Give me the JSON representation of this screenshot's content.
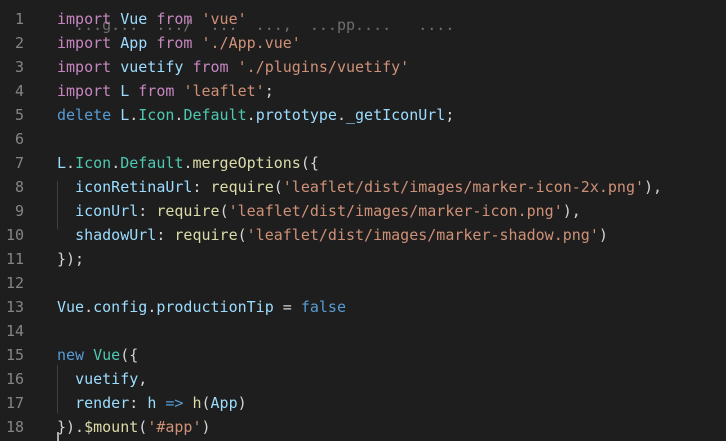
{
  "editor": {
    "top_partial_text": "  ...g...  .../  ...  ...,  ...pp....   ....",
    "lines": [
      {
        "num": "1",
        "tokens": [
          {
            "t": "import",
            "c": "kw"
          },
          {
            "t": " ",
            "c": "pun"
          },
          {
            "t": "Vue",
            "c": "id"
          },
          {
            "t": " ",
            "c": "pun"
          },
          {
            "t": "from",
            "c": "kw"
          },
          {
            "t": " ",
            "c": "pun"
          },
          {
            "t": "'vue'",
            "c": "str"
          }
        ]
      },
      {
        "num": "2",
        "tokens": [
          {
            "t": "import",
            "c": "kw"
          },
          {
            "t": " ",
            "c": "pun"
          },
          {
            "t": "App",
            "c": "id"
          },
          {
            "t": " ",
            "c": "pun"
          },
          {
            "t": "from",
            "c": "kw"
          },
          {
            "t": " ",
            "c": "pun"
          },
          {
            "t": "'./App.vue'",
            "c": "str"
          }
        ]
      },
      {
        "num": "3",
        "tokens": [
          {
            "t": "import",
            "c": "kw"
          },
          {
            "t": " ",
            "c": "pun"
          },
          {
            "t": "vuetify",
            "c": "id"
          },
          {
            "t": " ",
            "c": "pun"
          },
          {
            "t": "from",
            "c": "kw"
          },
          {
            "t": " ",
            "c": "pun"
          },
          {
            "t": "'./plugins/vuetify'",
            "c": "str"
          }
        ]
      },
      {
        "num": "4",
        "tokens": [
          {
            "t": "import",
            "c": "kw"
          },
          {
            "t": " ",
            "c": "pun"
          },
          {
            "t": "L",
            "c": "id"
          },
          {
            "t": " ",
            "c": "pun"
          },
          {
            "t": "from",
            "c": "kw"
          },
          {
            "t": " ",
            "c": "pun"
          },
          {
            "t": "'leaflet'",
            "c": "str"
          },
          {
            "t": ";",
            "c": "pun"
          }
        ]
      },
      {
        "num": "5",
        "tokens": [
          {
            "t": "delete",
            "c": "kw2"
          },
          {
            "t": " ",
            "c": "pun"
          },
          {
            "t": "L",
            "c": "id"
          },
          {
            "t": ".",
            "c": "pun"
          },
          {
            "t": "Icon",
            "c": "cls"
          },
          {
            "t": ".",
            "c": "pun"
          },
          {
            "t": "Default",
            "c": "cls"
          },
          {
            "t": ".",
            "c": "pun"
          },
          {
            "t": "prototype",
            "c": "id"
          },
          {
            "t": ".",
            "c": "pun"
          },
          {
            "t": "_getIconUrl",
            "c": "id"
          },
          {
            "t": ";",
            "c": "pun"
          }
        ]
      },
      {
        "num": "6",
        "tokens": []
      },
      {
        "num": "7",
        "tokens": [
          {
            "t": "L",
            "c": "id"
          },
          {
            "t": ".",
            "c": "pun"
          },
          {
            "t": "Icon",
            "c": "cls"
          },
          {
            "t": ".",
            "c": "pun"
          },
          {
            "t": "Default",
            "c": "cls"
          },
          {
            "t": ".",
            "c": "pun"
          },
          {
            "t": "mergeOptions",
            "c": "fn"
          },
          {
            "t": "({",
            "c": "pun"
          }
        ]
      },
      {
        "num": "8",
        "tokens": [
          {
            "t": "  ",
            "c": "pun"
          },
          {
            "t": "iconRetinaUrl",
            "c": "id"
          },
          {
            "t": ": ",
            "c": "pun"
          },
          {
            "t": "require",
            "c": "fn"
          },
          {
            "t": "(",
            "c": "pun"
          },
          {
            "t": "'leaflet/dist/images/marker-icon-2x.png'",
            "c": "str"
          },
          {
            "t": "),",
            "c": "pun"
          }
        ]
      },
      {
        "num": "9",
        "tokens": [
          {
            "t": "  ",
            "c": "pun"
          },
          {
            "t": "iconUrl",
            "c": "id"
          },
          {
            "t": ": ",
            "c": "pun"
          },
          {
            "t": "require",
            "c": "fn"
          },
          {
            "t": "(",
            "c": "pun"
          },
          {
            "t": "'leaflet/dist/images/marker-icon.png'",
            "c": "str"
          },
          {
            "t": "),",
            "c": "pun"
          }
        ]
      },
      {
        "num": "10",
        "tokens": [
          {
            "t": "  ",
            "c": "pun"
          },
          {
            "t": "shadowUrl",
            "c": "id"
          },
          {
            "t": ": ",
            "c": "pun"
          },
          {
            "t": "require",
            "c": "fn"
          },
          {
            "t": "(",
            "c": "pun"
          },
          {
            "t": "'leaflet/dist/images/marker-shadow.png'",
            "c": "str"
          },
          {
            "t": ")",
            "c": "pun"
          }
        ]
      },
      {
        "num": "11",
        "tokens": [
          {
            "t": "});",
            "c": "pun"
          }
        ]
      },
      {
        "num": "12",
        "tokens": []
      },
      {
        "num": "13",
        "tokens": [
          {
            "t": "Vue",
            "c": "id"
          },
          {
            "t": ".",
            "c": "pun"
          },
          {
            "t": "config",
            "c": "id"
          },
          {
            "t": ".",
            "c": "pun"
          },
          {
            "t": "productionTip",
            "c": "id"
          },
          {
            "t": " = ",
            "c": "pun"
          },
          {
            "t": "false",
            "c": "kw2"
          }
        ]
      },
      {
        "num": "14",
        "tokens": []
      },
      {
        "num": "15",
        "tokens": [
          {
            "t": "new",
            "c": "kw2"
          },
          {
            "t": " ",
            "c": "pun"
          },
          {
            "t": "Vue",
            "c": "cls"
          },
          {
            "t": "({",
            "c": "pun"
          }
        ]
      },
      {
        "num": "16",
        "tokens": [
          {
            "t": "  ",
            "c": "pun"
          },
          {
            "t": "vuetify",
            "c": "id"
          },
          {
            "t": ",",
            "c": "pun"
          }
        ]
      },
      {
        "num": "17",
        "tokens": [
          {
            "t": "  ",
            "c": "pun"
          },
          {
            "t": "render",
            "c": "id"
          },
          {
            "t": ": ",
            "c": "pun"
          },
          {
            "t": "h",
            "c": "id"
          },
          {
            "t": " ",
            "c": "pun"
          },
          {
            "t": "=>",
            "c": "kw2"
          },
          {
            "t": " ",
            "c": "pun"
          },
          {
            "t": "h",
            "c": "fn"
          },
          {
            "t": "(",
            "c": "pun"
          },
          {
            "t": "App",
            "c": "id"
          },
          {
            "t": ")",
            "c": "pun"
          }
        ]
      },
      {
        "num": "18",
        "tokens": [
          {
            "t": "}).",
            "c": "pun"
          },
          {
            "t": "$mount",
            "c": "fn"
          },
          {
            "t": "(",
            "c": "pun"
          },
          {
            "t": "'#app'",
            "c": "str"
          },
          {
            "t": ")",
            "c": "pun"
          }
        ]
      }
    ]
  }
}
